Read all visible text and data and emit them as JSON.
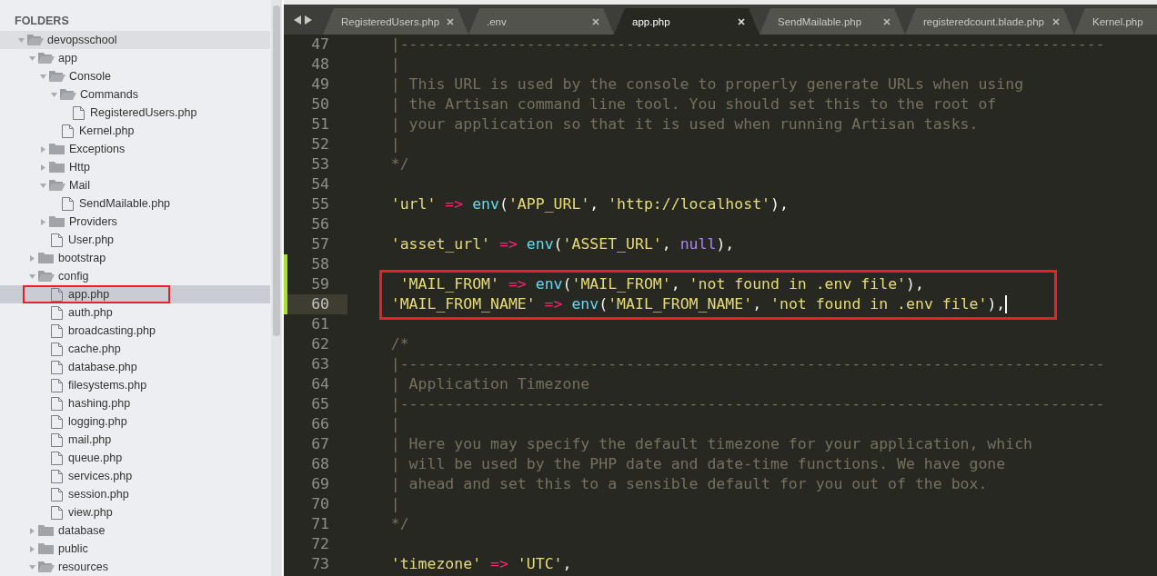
{
  "sidebar": {
    "title": "FOLDERS",
    "tree": [
      {
        "name": "devopsschool",
        "kind": "folder",
        "expanded": true,
        "selected": false,
        "boxed": false,
        "children": [
          {
            "name": "app",
            "kind": "folder",
            "expanded": true,
            "selected": false,
            "boxed": false,
            "children": [
              {
                "name": "Console",
                "kind": "folder",
                "expanded": true,
                "selected": false,
                "boxed": false,
                "children": [
                  {
                    "name": "Commands",
                    "kind": "folder",
                    "expanded": true,
                    "selected": false,
                    "boxed": false,
                    "children": [
                      {
                        "name": "RegisteredUsers.php",
                        "kind": "file",
                        "selected": false,
                        "boxed": false
                      }
                    ]
                  },
                  {
                    "name": "Kernel.php",
                    "kind": "file",
                    "selected": false,
                    "boxed": false
                  }
                ]
              },
              {
                "name": "Exceptions",
                "kind": "folder",
                "expanded": false,
                "selected": false,
                "boxed": false
              },
              {
                "name": "Http",
                "kind": "folder",
                "expanded": false,
                "selected": false,
                "boxed": false
              },
              {
                "name": "Mail",
                "kind": "folder",
                "expanded": true,
                "selected": false,
                "boxed": false,
                "children": [
                  {
                    "name": "SendMailable.php",
                    "kind": "file",
                    "selected": false,
                    "boxed": false
                  }
                ]
              },
              {
                "name": "Providers",
                "kind": "folder",
                "expanded": false,
                "selected": false,
                "boxed": false
              },
              {
                "name": "User.php",
                "kind": "file",
                "selected": false,
                "boxed": false
              }
            ]
          },
          {
            "name": "bootstrap",
            "kind": "folder",
            "expanded": false,
            "selected": false,
            "boxed": false
          },
          {
            "name": "config",
            "kind": "folder",
            "expanded": true,
            "selected": false,
            "boxed": false,
            "children": [
              {
                "name": "app.php",
                "kind": "file",
                "selected": true,
                "boxed": true
              },
              {
                "name": "auth.php",
                "kind": "file",
                "selected": false,
                "boxed": false
              },
              {
                "name": "broadcasting.php",
                "kind": "file",
                "selected": false,
                "boxed": false
              },
              {
                "name": "cache.php",
                "kind": "file",
                "selected": false,
                "boxed": false
              },
              {
                "name": "database.php",
                "kind": "file",
                "selected": false,
                "boxed": false
              },
              {
                "name": "filesystems.php",
                "kind": "file",
                "selected": false,
                "boxed": false
              },
              {
                "name": "hashing.php",
                "kind": "file",
                "selected": false,
                "boxed": false
              },
              {
                "name": "logging.php",
                "kind": "file",
                "selected": false,
                "boxed": false
              },
              {
                "name": "mail.php",
                "kind": "file",
                "selected": false,
                "boxed": false
              },
              {
                "name": "queue.php",
                "kind": "file",
                "selected": false,
                "boxed": false
              },
              {
                "name": "services.php",
                "kind": "file",
                "selected": false,
                "boxed": false
              },
              {
                "name": "session.php",
                "kind": "file",
                "selected": false,
                "boxed": false
              },
              {
                "name": "view.php",
                "kind": "file",
                "selected": false,
                "boxed": false
              }
            ]
          },
          {
            "name": "database",
            "kind": "folder",
            "expanded": false,
            "selected": false,
            "boxed": false
          },
          {
            "name": "public",
            "kind": "folder",
            "expanded": false,
            "selected": false,
            "boxed": false
          },
          {
            "name": "resources",
            "kind": "folder",
            "expanded": true,
            "selected": false,
            "boxed": false
          }
        ]
      }
    ]
  },
  "tabs": [
    {
      "label": "RegisteredUsers.php",
      "selected": false
    },
    {
      "label": ".env",
      "selected": false
    },
    {
      "label": "app.php",
      "selected": true
    },
    {
      "label": "SendMailable.php",
      "selected": false
    },
    {
      "label": "registeredcount.blade.php",
      "selected": false
    },
    {
      "label": "Kernel.php",
      "selected": false
    }
  ],
  "editor": {
    "lines": [
      {
        "number": "47",
        "modified": false,
        "current": false,
        "boxed": false,
        "tokens": [
          {
            "kind": "comment",
            "text": "    |------------------------------------------------------------------------------"
          }
        ]
      },
      {
        "number": "48",
        "modified": false,
        "current": false,
        "boxed": false,
        "tokens": [
          {
            "kind": "comment",
            "text": "    |"
          }
        ]
      },
      {
        "number": "49",
        "modified": false,
        "current": false,
        "boxed": false,
        "tokens": [
          {
            "kind": "comment",
            "text": "    | This URL is used by the console to properly generate URLs when using"
          }
        ]
      },
      {
        "number": "50",
        "modified": false,
        "current": false,
        "boxed": false,
        "tokens": [
          {
            "kind": "comment",
            "text": "    | the Artisan command line tool. You should set this to the root of"
          }
        ]
      },
      {
        "number": "51",
        "modified": false,
        "current": false,
        "boxed": false,
        "tokens": [
          {
            "kind": "comment",
            "text": "    | your application so that it is used when running Artisan tasks."
          }
        ]
      },
      {
        "number": "52",
        "modified": false,
        "current": false,
        "boxed": false,
        "tokens": [
          {
            "kind": "comment",
            "text": "    |"
          }
        ]
      },
      {
        "number": "53",
        "modified": false,
        "current": false,
        "boxed": false,
        "tokens": [
          {
            "kind": "comment",
            "text": "    */"
          }
        ]
      },
      {
        "number": "54",
        "modified": false,
        "current": false,
        "boxed": false
      },
      {
        "number": "55",
        "modified": false,
        "current": false,
        "boxed": false,
        "tokens": [
          {
            "kind": "string",
            "text": "    'url'"
          },
          {
            "kind": "operator",
            "text": " => "
          },
          {
            "kind": "function",
            "text": "env"
          },
          {
            "kind": "plain",
            "text": "("
          },
          {
            "kind": "string",
            "text": "'APP_URL'"
          },
          {
            "kind": "plain",
            "text": ", "
          },
          {
            "kind": "string",
            "text": "'http://localhost'"
          },
          {
            "kind": "plain",
            "text": "),"
          }
        ]
      },
      {
        "number": "56",
        "modified": false,
        "current": false,
        "boxed": false
      },
      {
        "number": "57",
        "modified": false,
        "current": false,
        "boxed": false,
        "tokens": [
          {
            "kind": "string",
            "text": "    'asset_url'"
          },
          {
            "kind": "operator",
            "text": " => "
          },
          {
            "kind": "function",
            "text": "env"
          },
          {
            "kind": "plain",
            "text": "("
          },
          {
            "kind": "string",
            "text": "'ASSET_URL'"
          },
          {
            "kind": "plain",
            "text": ", "
          },
          {
            "kind": "constant",
            "text": "null"
          },
          {
            "kind": "plain",
            "text": "),"
          }
        ]
      },
      {
        "number": "58",
        "modified": true,
        "current": false,
        "boxed": false
      },
      {
        "number": "59",
        "modified": true,
        "current": false,
        "boxed": true,
        "tokens": [
          {
            "kind": "string",
            "text": "     'MAIL_FROM'"
          },
          {
            "kind": "operator",
            "text": " => "
          },
          {
            "kind": "function",
            "text": "env"
          },
          {
            "kind": "plain",
            "text": "("
          },
          {
            "kind": "string",
            "text": "'MAIL_FROM'"
          },
          {
            "kind": "plain",
            "text": ", "
          },
          {
            "kind": "string",
            "text": "'not found in .env file'"
          },
          {
            "kind": "plain",
            "text": "),"
          }
        ]
      },
      {
        "number": "60",
        "modified": true,
        "current": true,
        "boxed": true,
        "tokens": [
          {
            "kind": "string",
            "text": "    'MAIL_FROM_NAME'"
          },
          {
            "kind": "operator",
            "text": " => "
          },
          {
            "kind": "function",
            "text": "env"
          },
          {
            "kind": "plain",
            "text": "("
          },
          {
            "kind": "string",
            "text": "'MAIL_FROM_NAME'"
          },
          {
            "kind": "plain",
            "text": ", "
          },
          {
            "kind": "string",
            "text": "'not found in .env file'"
          },
          {
            "kind": "plain",
            "text": "),"
          }
        ]
      },
      {
        "number": "61",
        "modified": false,
        "current": false,
        "boxed": false
      },
      {
        "number": "62",
        "modified": false,
        "current": false,
        "boxed": false,
        "tokens": [
          {
            "kind": "comment",
            "text": "    /*"
          }
        ]
      },
      {
        "number": "63",
        "modified": false,
        "current": false,
        "boxed": false,
        "tokens": [
          {
            "kind": "comment",
            "text": "    |------------------------------------------------------------------------------"
          }
        ]
      },
      {
        "number": "64",
        "modified": false,
        "current": false,
        "boxed": false,
        "tokens": [
          {
            "kind": "comment",
            "text": "    | Application Timezone"
          }
        ]
      },
      {
        "number": "65",
        "modified": false,
        "current": false,
        "boxed": false,
        "tokens": [
          {
            "kind": "comment",
            "text": "    |------------------------------------------------------------------------------"
          }
        ]
      },
      {
        "number": "66",
        "modified": false,
        "current": false,
        "boxed": false,
        "tokens": [
          {
            "kind": "comment",
            "text": "    |"
          }
        ]
      },
      {
        "number": "67",
        "modified": false,
        "current": false,
        "boxed": false,
        "tokens": [
          {
            "kind": "comment",
            "text": "    | Here you may specify the default timezone for your application, which"
          }
        ]
      },
      {
        "number": "68",
        "modified": false,
        "current": false,
        "boxed": false,
        "tokens": [
          {
            "kind": "comment",
            "text": "    | will be used by the PHP date and date-time functions. We have gone"
          }
        ]
      },
      {
        "number": "69",
        "modified": false,
        "current": false,
        "boxed": false,
        "tokens": [
          {
            "kind": "comment",
            "text": "    | ahead and set this to a sensible default for you out of the box."
          }
        ]
      },
      {
        "number": "70",
        "modified": false,
        "current": false,
        "boxed": false,
        "tokens": [
          {
            "kind": "comment",
            "text": "    |"
          }
        ]
      },
      {
        "number": "71",
        "modified": false,
        "current": false,
        "boxed": false,
        "tokens": [
          {
            "kind": "comment",
            "text": "    */"
          }
        ]
      },
      {
        "number": "72",
        "modified": false,
        "current": false,
        "boxed": false
      },
      {
        "number": "73",
        "modified": false,
        "current": false,
        "boxed": false,
        "tokens": [
          {
            "kind": "string",
            "text": "    'timezone'"
          },
          {
            "kind": "operator",
            "text": " => "
          },
          {
            "kind": "string",
            "text": "'UTC'"
          },
          {
            "kind": "plain",
            "text": ","
          }
        ]
      }
    ]
  }
}
